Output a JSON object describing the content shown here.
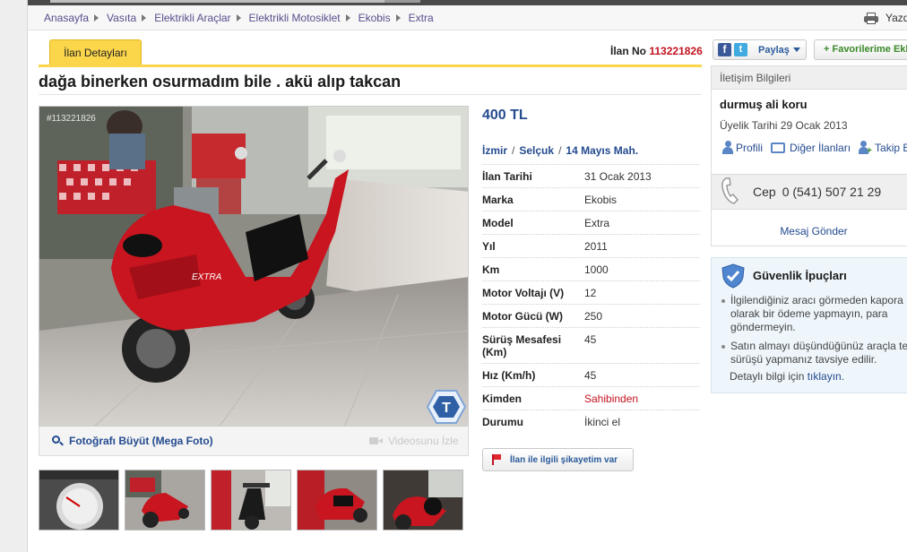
{
  "breadcrumb": [
    "Anasayfa",
    "Vasıta",
    "Elektrikli Araçlar",
    "Elektrikli Motosiklet",
    "Ekobis",
    "Extra"
  ],
  "print_label": "Yazdır",
  "tab_label": "İlan Detayları",
  "listing": {
    "no_label": "İlan No",
    "no_value": "113221826",
    "title": "dağa binerken osurmadım bile . akü alıp takcan",
    "price": "400 TL",
    "location": [
      "İzmir",
      "Selçuk",
      "14 Mayıs Mah."
    ],
    "photo_watermark": "#113221826",
    "enlarge_label": "Fotoğrafı Büyüt (Mega Foto)",
    "video_label": "Videosunu İzle",
    "report_label": "İlan ile ilgili şikayetim var"
  },
  "specs": [
    {
      "key": "İlan Tarihi",
      "value": "31 Ocak 2013"
    },
    {
      "key": "Marka",
      "value": "Ekobis"
    },
    {
      "key": "Model",
      "value": "Extra"
    },
    {
      "key": "Yıl",
      "value": "2011"
    },
    {
      "key": "Km",
      "value": "1000"
    },
    {
      "key": "Motor Voltajı (V)",
      "value": "12"
    },
    {
      "key": "Motor Gücü (W)",
      "value": "250"
    },
    {
      "key": "Sürüş Mesafesi (Km)",
      "value": "45"
    },
    {
      "key": "Hız (Km/h)",
      "value": "45"
    },
    {
      "key": "Kimden",
      "value": "Sahibinden"
    },
    {
      "key": "Durumu",
      "value": "İkinci el"
    }
  ],
  "share": {
    "label": "Paylaş",
    "fb": "f",
    "tw": "t"
  },
  "favorite_label": "+ Favorilerime Ekle",
  "contact": {
    "header": "İletişim Bilgileri",
    "name": "durmuş ali koru",
    "member_since": "Üyelik Tarihi 29 Ocak 2013",
    "profile": "Profili",
    "other_ads": "Diğer İlanları",
    "follow": "Takip Et",
    "phone_label": "Cep",
    "phone": "0 (541) 507 21 29",
    "message": "Mesaj Gönder"
  },
  "safety": {
    "title": "Güvenlik İpuçları",
    "tips": [
      "İlgilendiğiniz aracı görmeden kapora olarak bir ödeme yapmayın, para göndermeyin.",
      "Satın almayı düşündüğünüz araçla test sürüşü yapmanız tavsiye edilir."
    ],
    "more_prefix": "Detaylı bilgi için",
    "more_link": "tıklayın."
  },
  "colors": {
    "accent_yellow": "#fbd64b",
    "link_blue": "#244b8f",
    "red": "#c1121f",
    "crumb_purple": "#5a4d8c"
  },
  "icons": [
    "print-icon",
    "facebook-icon",
    "twitter-icon",
    "search-icon",
    "video-camera-icon",
    "flag-icon",
    "person-icon",
    "list-icon",
    "follow-icon",
    "phone-icon",
    "shield-icon",
    "t-badge-icon"
  ]
}
